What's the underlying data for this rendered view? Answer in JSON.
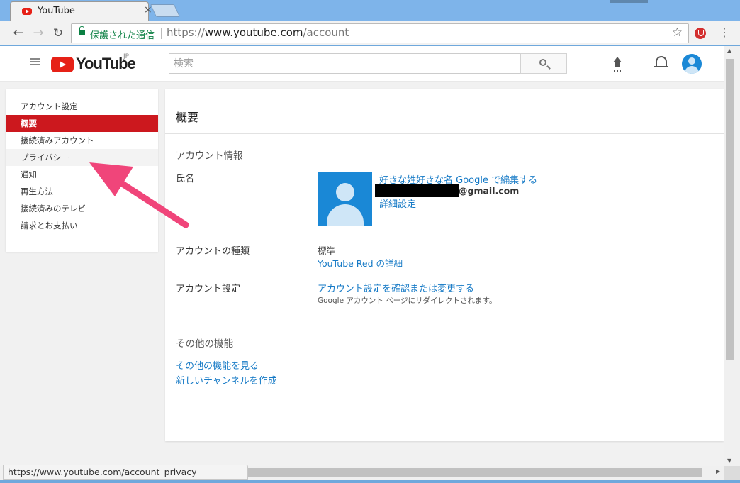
{
  "browser": {
    "tab_title": "YouTube",
    "tab_close": "×",
    "secure_label": "保護された通信",
    "url_scheme": "https://",
    "url_host": "www.youtube.com",
    "url_path": "/account",
    "status_url": "https://www.youtube.com/account_privacy"
  },
  "header": {
    "logo_text": "YouTube",
    "region": "JP",
    "search_placeholder": "検索"
  },
  "sidebar": {
    "items": [
      {
        "label": "アカウント設定",
        "state": "normal"
      },
      {
        "label": "概要",
        "state": "active"
      },
      {
        "label": "接続済みアカウント",
        "state": "normal"
      },
      {
        "label": "プライバシー",
        "state": "hover"
      },
      {
        "label": "通知",
        "state": "normal"
      },
      {
        "label": "再生方法",
        "state": "normal"
      },
      {
        "label": "接続済みのテレビ",
        "state": "normal"
      },
      {
        "label": "請求とお支払い",
        "state": "normal"
      }
    ]
  },
  "main": {
    "title": "概要",
    "account_info_title": "アカウント情報",
    "name_label": "氏名",
    "name_link": "好きな姓好きな名 Google で編集する",
    "email_domain": "@gmail.com",
    "advanced_link": "詳細設定",
    "account_type_label": "アカウントの種類",
    "account_type_value": "標準",
    "youtube_red_link": "YouTube Red の詳細",
    "account_settings_label": "アカウント設定",
    "account_settings_link": "アカウント設定を確認または変更する",
    "account_settings_note": "Google アカウント ページにリダイレクトされます。",
    "other_features_title": "その他の機能",
    "view_features_link": "その他の機能を見る",
    "create_channel_link": "新しいチャンネルを作成"
  },
  "colors": {
    "accent": "#cc181e",
    "link": "#167ac6",
    "annotation_arrow": "#f0457a"
  }
}
